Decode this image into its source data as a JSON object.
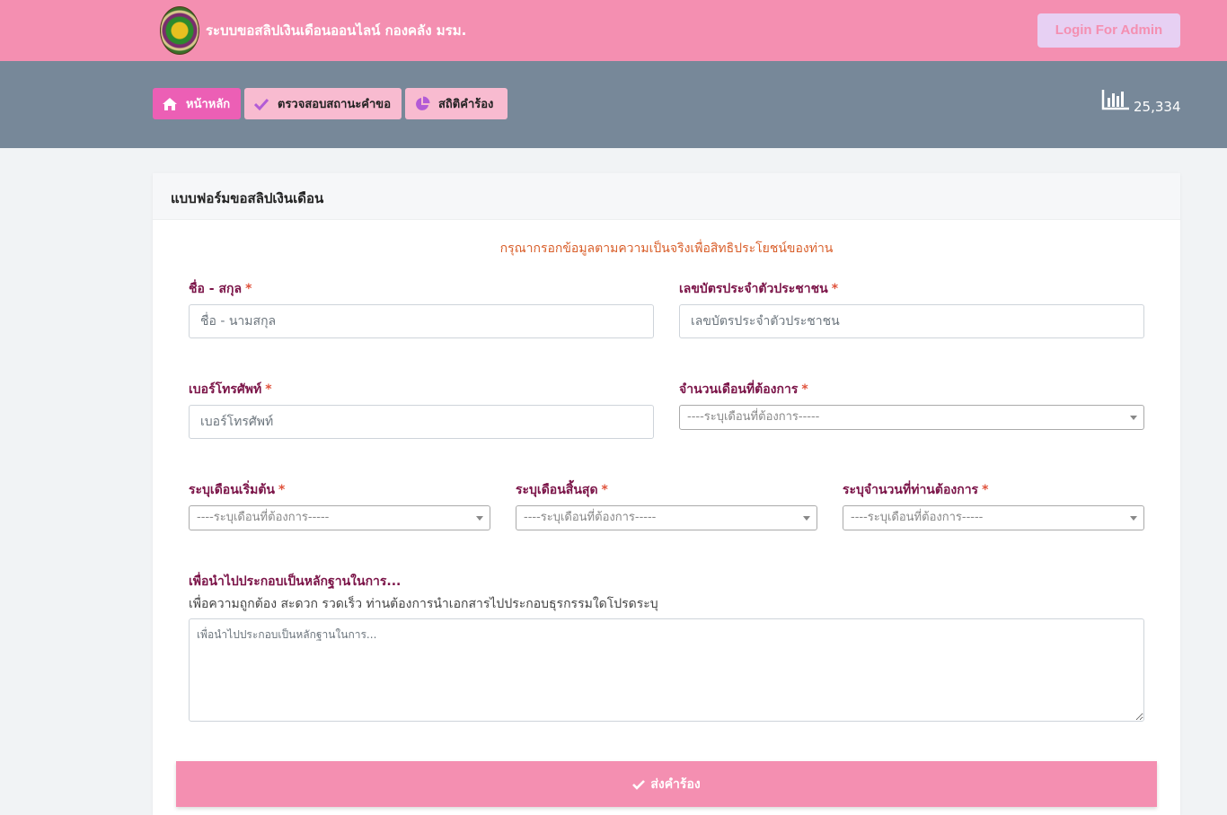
{
  "header": {
    "title": "ระบบขอสลิปเงินเดือนออนไลน์ กองคลัง มรม.",
    "admin_button": "Login For  Admin",
    "brand_color": "#f48fb1"
  },
  "nav": {
    "items": [
      {
        "label": "หน้าหลัก",
        "icon": "home-icon"
      },
      {
        "label": "ตรวจสอบสถานะคำขอ",
        "icon": "check-icon"
      },
      {
        "label": "สถิติคำร้อง",
        "icon": "pie-chart-icon"
      }
    ],
    "visitor_count": "25,334",
    "counter_icon": "bar-chart-icon"
  },
  "form": {
    "title": "แบบฟอร์มขอสลิปเงินเดือน",
    "notice": "กรุณากรอกข้อมูลตามความเป็นจริงเพื่อสิทธิประโยชน์ของท่าน",
    "required_mark": "*",
    "fields": {
      "name": {
        "label": "ชื่อ - สกุล",
        "placeholder": "ชื่อ - นามสกุล"
      },
      "citizen_id": {
        "label": "เลขบัตรประจำตัวประชาชน",
        "placeholder": "เลขบัตรประจำตัวประชาชน"
      },
      "phone": {
        "label": "เบอร์โทรศัพท์",
        "placeholder": "เบอร์โทรศัพท์"
      },
      "month_count": {
        "label": "จำนวนเดือนที่ต้องการ",
        "value": "----ระบุเดือนที่ต้องการ-----"
      },
      "start_month": {
        "label": "ระบุเดือนเริ่มต้น",
        "value": "----ระบุเดือนที่ต้องการ-----"
      },
      "end_month": {
        "label": "ระบุเดือนสิ้นสุด",
        "value": "----ระบุเดือนที่ต้องการ-----"
      },
      "quantity": {
        "label": "ระบุจำนวนที่ท่านต้องการ",
        "value": "----ระบุเดือนที่ต้องการ-----"
      },
      "purpose": {
        "label": "เพื่อนำไปประกอบเป็นหลักฐานในการ...",
        "help": "เพื่อความถูกต้อง สะดวก รวดเร็ว ท่านต้องการนำเอกสารไปประกอบธุรกรรมใดโปรดระบุ",
        "placeholder": "เพื่อนำไปประกอบเป็นหลักฐานในการ..."
      }
    },
    "submit_label": "ส่งคำร้อง"
  }
}
